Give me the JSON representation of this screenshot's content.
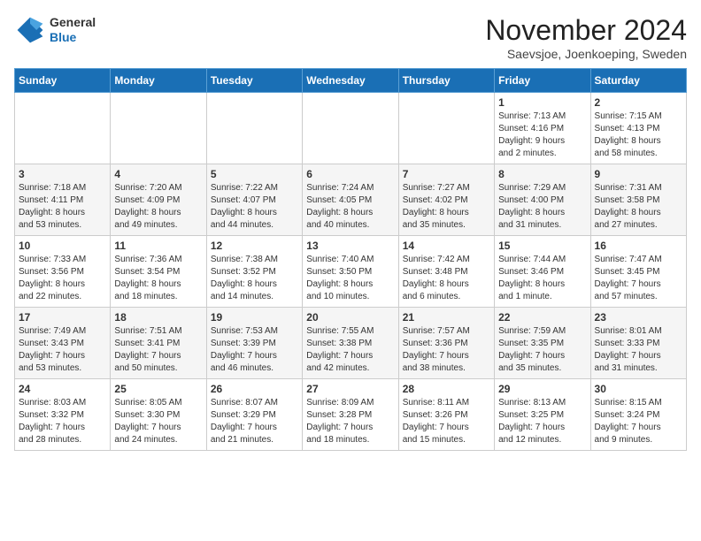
{
  "header": {
    "logo_general": "General",
    "logo_blue": "Blue",
    "month_title": "November 2024",
    "location": "Saevsjoe, Joenkoeping, Sweden"
  },
  "days_of_week": [
    "Sunday",
    "Monday",
    "Tuesday",
    "Wednesday",
    "Thursday",
    "Friday",
    "Saturday"
  ],
  "weeks": [
    [
      {
        "day": "",
        "info": ""
      },
      {
        "day": "",
        "info": ""
      },
      {
        "day": "",
        "info": ""
      },
      {
        "day": "",
        "info": ""
      },
      {
        "day": "",
        "info": ""
      },
      {
        "day": "1",
        "info": "Sunrise: 7:13 AM\nSunset: 4:16 PM\nDaylight: 9 hours\nand 2 minutes."
      },
      {
        "day": "2",
        "info": "Sunrise: 7:15 AM\nSunset: 4:13 PM\nDaylight: 8 hours\nand 58 minutes."
      }
    ],
    [
      {
        "day": "3",
        "info": "Sunrise: 7:18 AM\nSunset: 4:11 PM\nDaylight: 8 hours\nand 53 minutes."
      },
      {
        "day": "4",
        "info": "Sunrise: 7:20 AM\nSunset: 4:09 PM\nDaylight: 8 hours\nand 49 minutes."
      },
      {
        "day": "5",
        "info": "Sunrise: 7:22 AM\nSunset: 4:07 PM\nDaylight: 8 hours\nand 44 minutes."
      },
      {
        "day": "6",
        "info": "Sunrise: 7:24 AM\nSunset: 4:05 PM\nDaylight: 8 hours\nand 40 minutes."
      },
      {
        "day": "7",
        "info": "Sunrise: 7:27 AM\nSunset: 4:02 PM\nDaylight: 8 hours\nand 35 minutes."
      },
      {
        "day": "8",
        "info": "Sunrise: 7:29 AM\nSunset: 4:00 PM\nDaylight: 8 hours\nand 31 minutes."
      },
      {
        "day": "9",
        "info": "Sunrise: 7:31 AM\nSunset: 3:58 PM\nDaylight: 8 hours\nand 27 minutes."
      }
    ],
    [
      {
        "day": "10",
        "info": "Sunrise: 7:33 AM\nSunset: 3:56 PM\nDaylight: 8 hours\nand 22 minutes."
      },
      {
        "day": "11",
        "info": "Sunrise: 7:36 AM\nSunset: 3:54 PM\nDaylight: 8 hours\nand 18 minutes."
      },
      {
        "day": "12",
        "info": "Sunrise: 7:38 AM\nSunset: 3:52 PM\nDaylight: 8 hours\nand 14 minutes."
      },
      {
        "day": "13",
        "info": "Sunrise: 7:40 AM\nSunset: 3:50 PM\nDaylight: 8 hours\nand 10 minutes."
      },
      {
        "day": "14",
        "info": "Sunrise: 7:42 AM\nSunset: 3:48 PM\nDaylight: 8 hours\nand 6 minutes."
      },
      {
        "day": "15",
        "info": "Sunrise: 7:44 AM\nSunset: 3:46 PM\nDaylight: 8 hours\nand 1 minute."
      },
      {
        "day": "16",
        "info": "Sunrise: 7:47 AM\nSunset: 3:45 PM\nDaylight: 7 hours\nand 57 minutes."
      }
    ],
    [
      {
        "day": "17",
        "info": "Sunrise: 7:49 AM\nSunset: 3:43 PM\nDaylight: 7 hours\nand 53 minutes."
      },
      {
        "day": "18",
        "info": "Sunrise: 7:51 AM\nSunset: 3:41 PM\nDaylight: 7 hours\nand 50 minutes."
      },
      {
        "day": "19",
        "info": "Sunrise: 7:53 AM\nSunset: 3:39 PM\nDaylight: 7 hours\nand 46 minutes."
      },
      {
        "day": "20",
        "info": "Sunrise: 7:55 AM\nSunset: 3:38 PM\nDaylight: 7 hours\nand 42 minutes."
      },
      {
        "day": "21",
        "info": "Sunrise: 7:57 AM\nSunset: 3:36 PM\nDaylight: 7 hours\nand 38 minutes."
      },
      {
        "day": "22",
        "info": "Sunrise: 7:59 AM\nSunset: 3:35 PM\nDaylight: 7 hours\nand 35 minutes."
      },
      {
        "day": "23",
        "info": "Sunrise: 8:01 AM\nSunset: 3:33 PM\nDaylight: 7 hours\nand 31 minutes."
      }
    ],
    [
      {
        "day": "24",
        "info": "Sunrise: 8:03 AM\nSunset: 3:32 PM\nDaylight: 7 hours\nand 28 minutes."
      },
      {
        "day": "25",
        "info": "Sunrise: 8:05 AM\nSunset: 3:30 PM\nDaylight: 7 hours\nand 24 minutes."
      },
      {
        "day": "26",
        "info": "Sunrise: 8:07 AM\nSunset: 3:29 PM\nDaylight: 7 hours\nand 21 minutes."
      },
      {
        "day": "27",
        "info": "Sunrise: 8:09 AM\nSunset: 3:28 PM\nDaylight: 7 hours\nand 18 minutes."
      },
      {
        "day": "28",
        "info": "Sunrise: 8:11 AM\nSunset: 3:26 PM\nDaylight: 7 hours\nand 15 minutes."
      },
      {
        "day": "29",
        "info": "Sunrise: 8:13 AM\nSunset: 3:25 PM\nDaylight: 7 hours\nand 12 minutes."
      },
      {
        "day": "30",
        "info": "Sunrise: 8:15 AM\nSunset: 3:24 PM\nDaylight: 7 hours\nand 9 minutes."
      }
    ]
  ]
}
